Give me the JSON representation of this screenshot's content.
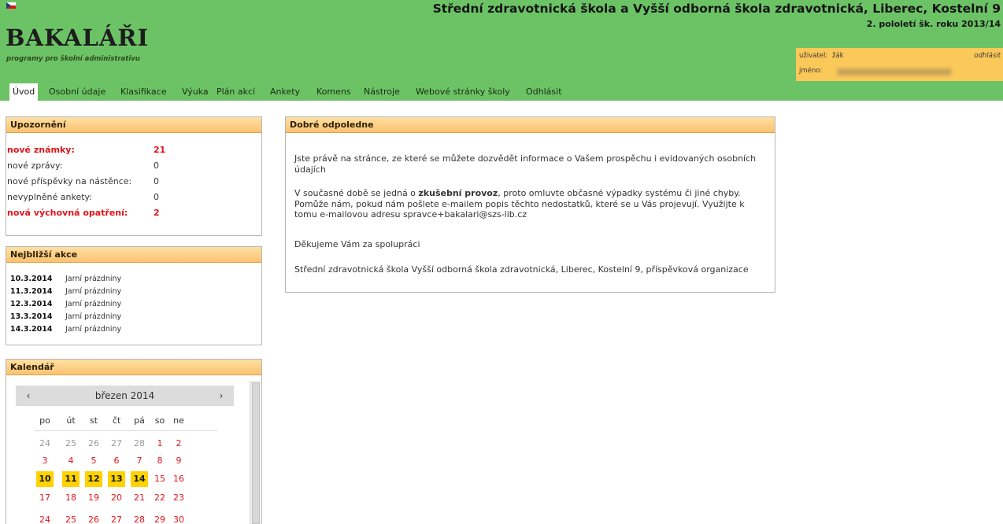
{
  "header": {
    "logo_text": "BAKALÁŘI",
    "logo_subtitle": "programy pro školní administrativu",
    "school_name": "Střední zdravotnická škola a Vyšší odborná škola zdravotnická, Liberec, Kostelní 9",
    "term": "2. pololetí šk. roku 2013/14",
    "user_label": "uživatel:",
    "user_value": "žák",
    "name_label": "jméno:",
    "logout_label": "odhlásit"
  },
  "nav": {
    "items": [
      "Úvod",
      "Osobní údaje",
      "Klasifikace",
      "Výuka",
      "Plán akcí",
      "Ankety",
      "Komens",
      "Nástroje",
      "Webové stránky školy",
      "Odhlásit"
    ]
  },
  "alerts": {
    "title": "Upozornění",
    "rows": [
      {
        "label": "nové známky:",
        "value": "21"
      },
      {
        "label": "nové zprávy:",
        "value": "0"
      },
      {
        "label": "nové příspěvky na nástěnce:",
        "value": "0"
      },
      {
        "label": "nevyplněné ankety:",
        "value": "0"
      },
      {
        "label": "nová výchovná opatření:",
        "value": "2"
      }
    ]
  },
  "events": {
    "title": "Nejbližší akce",
    "items": [
      {
        "date": "10.3.2014",
        "name": "Jarní prázdniny"
      },
      {
        "date": "11.3.2014",
        "name": "Jarní prázdniny"
      },
      {
        "date": "12.3.2014",
        "name": "Jarní prázdniny"
      },
      {
        "date": "13.3.2014",
        "name": "Jarní prázdniny"
      },
      {
        "date": "14.3.2014",
        "name": "Jarní prázdniny"
      }
    ]
  },
  "calendar": {
    "title": "Kalendář",
    "month": "březen 2014",
    "prev": "‹",
    "next": "›",
    "weekdays": [
      "po",
      "út",
      "st",
      "čt",
      "pá",
      "so",
      "ne"
    ],
    "weeks": [
      [
        "24",
        "25",
        "26",
        "27",
        "28",
        "1",
        "2"
      ],
      [
        "3",
        "4",
        "5",
        "6",
        "7",
        "8",
        "9"
      ],
      [
        "10",
        "11",
        "12",
        "13",
        "14",
        "15",
        "16"
      ],
      [
        "17",
        "18",
        "19",
        "20",
        "21",
        "22",
        "23"
      ],
      [
        "24",
        "25",
        "26",
        "27",
        "28",
        "29",
        "30"
      ]
    ]
  },
  "main": {
    "title": "Dobré odpoledne",
    "p1": "Jste právě na stránce, ze které se můžete dozvědět informace o Vašem prospěchu i evidovaných osobních údajích",
    "p2_before": "V současné době se jedná o ",
    "p2_bold": "zkušební provoz",
    "p2_after": ", proto omluvte občasné výpadky systému či jiné chyby. Pomůže nám, pokud nám pošlete e-mailem popis těchto nedostatků, které se u Vás projevují. Využijte k tomu e-mailovou adresu spravce+bakalari@szs-lib.cz",
    "p3": "Děkujeme Vám za spolupráci",
    "p4": "Střední zdravotnická škola Vyšší odborná škola zdravotnická, Liberec, Kostelní 9, příspěvková organizace"
  }
}
